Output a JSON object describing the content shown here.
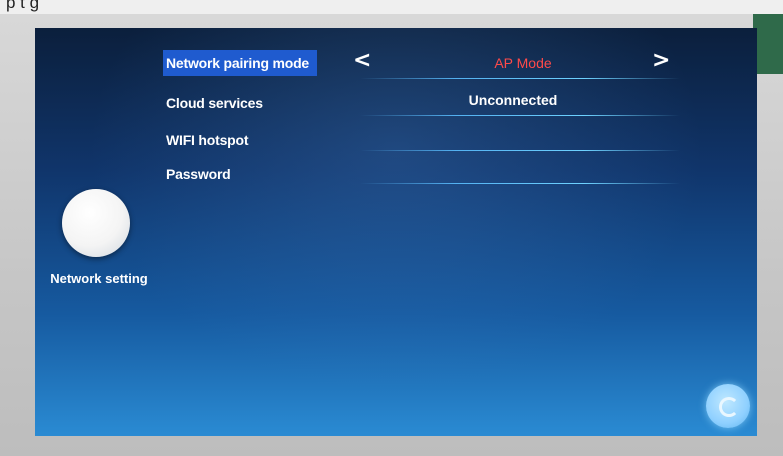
{
  "network_setting": {
    "rows": [
      {
        "label": "Network pairing mode",
        "value": "AP Mode"
      },
      {
        "label": "Cloud services",
        "value": "Unconnected"
      },
      {
        "label": "WIFI hotspot",
        "value": ""
      },
      {
        "label": "Password",
        "value": ""
      }
    ],
    "side_caption": "Network setting",
    "top_text": "p      t     g"
  },
  "colors": {
    "selected_bg": "#1f5bcf",
    "mode_value": "#ff4a4a",
    "line": "#6ed2ff"
  },
  "icons": {
    "left_arrow": "chevron-left-icon",
    "right_arrow": "chevron-right-icon",
    "side_button": "network-setting-circle-icon",
    "corner_button": "back-icon"
  }
}
